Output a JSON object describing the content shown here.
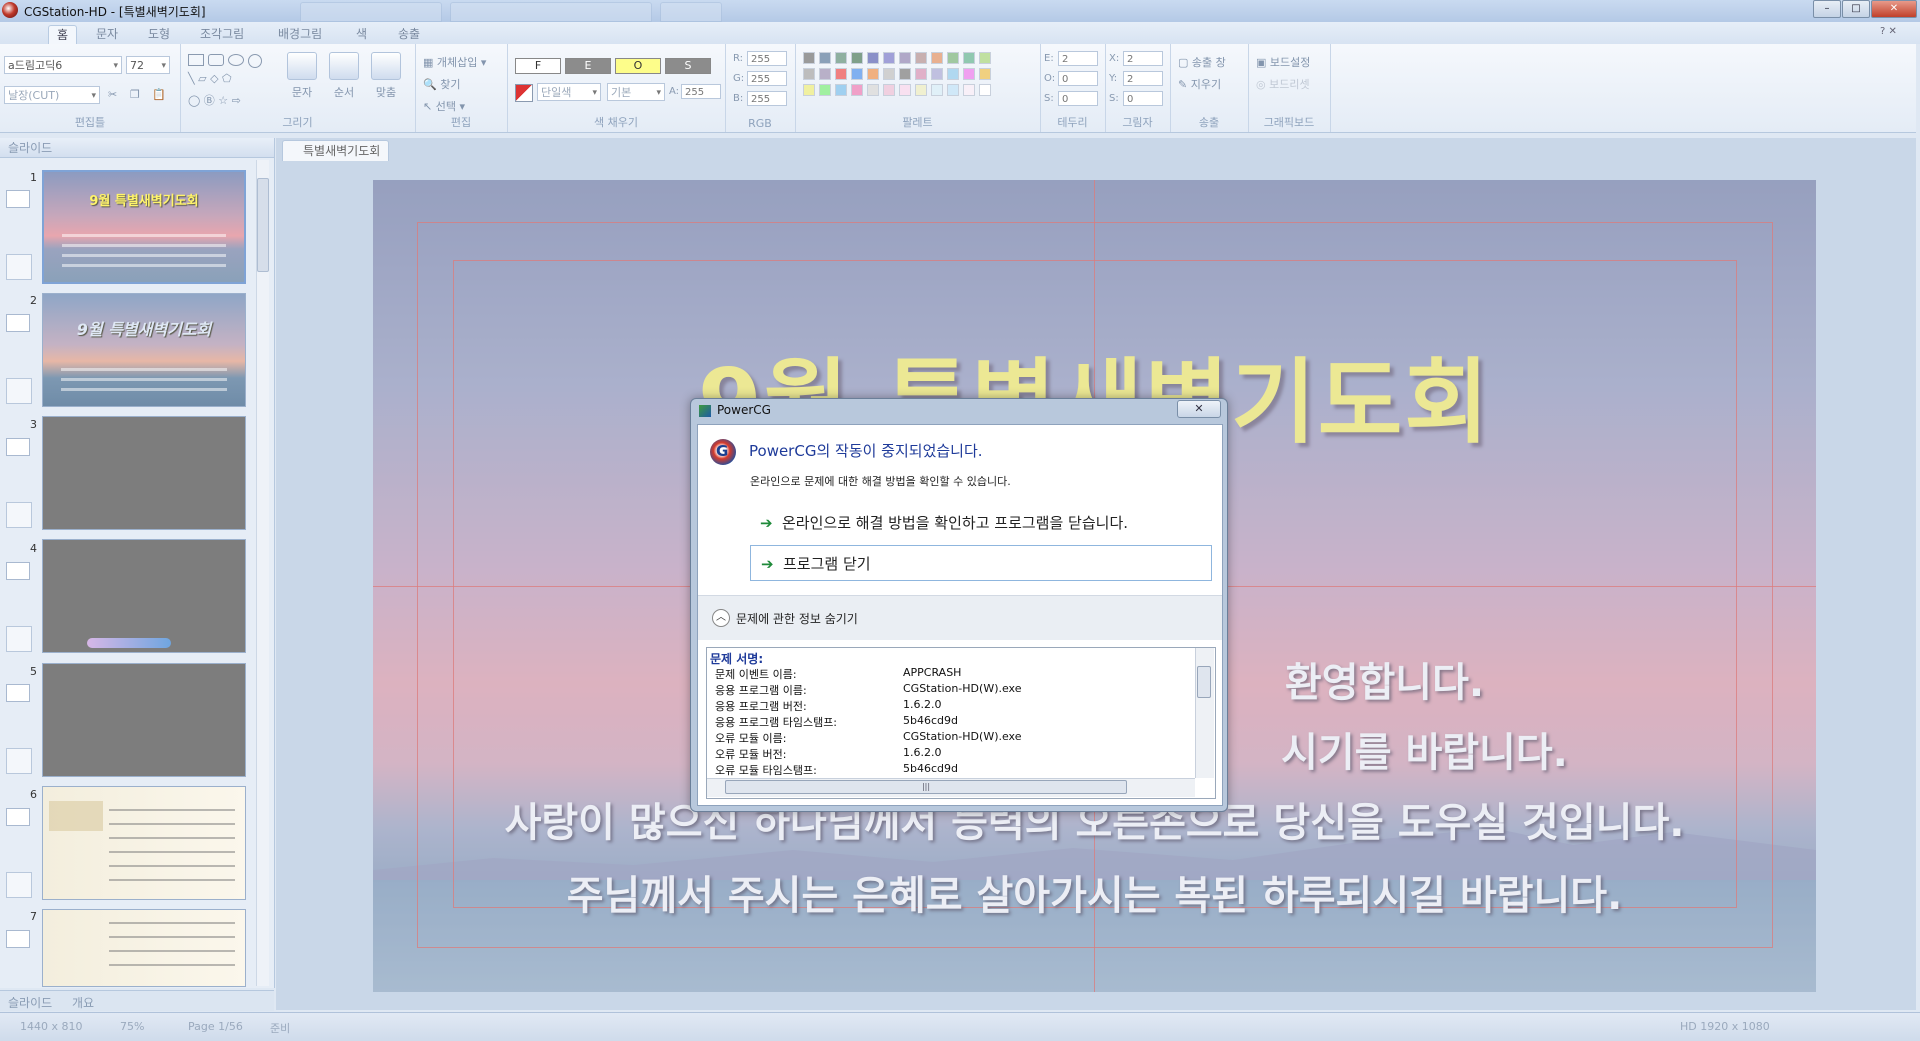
{
  "window": {
    "title": "CGStation-HD - [특별새벽기도회]",
    "controls": [
      "–",
      "□",
      "✕"
    ]
  },
  "ribbon": {
    "tabs": [
      "홈",
      "문자",
      "도형",
      "조각그림",
      "배경그림",
      "색",
      "송출"
    ],
    "help": "? ✕",
    "groups": {
      "edit_group": {
        "label": "편집틀",
        "font": "a드림고딕6",
        "size": "72",
        "mode": "날장(CUT)"
      },
      "draw": {
        "label": "그리기",
        "buttons": [
          "문자",
          "순서",
          "맞춤"
        ]
      },
      "edit": {
        "label": "편집",
        "items": [
          "개체삽입",
          "찾기",
          "선택"
        ]
      },
      "color_fill": {
        "label": "색 채우기",
        "boxes": [
          "F",
          "E",
          "O",
          "S"
        ],
        "fill_type": "단일색",
        "fill_style": "기본",
        "alpha_label": "A:",
        "alpha": "255"
      },
      "rgb": {
        "label": "RGB",
        "r_label": "R:",
        "g_label": "G:",
        "b_label": "B:",
        "r": "255",
        "g": "255",
        "b": "255"
      },
      "palette": {
        "label": "팔레트"
      },
      "border": {
        "label": "테두리",
        "e_label": "E:",
        "o_label": "O:",
        "s_label": "S:",
        "e": "2",
        "o": "0",
        "s": "0"
      },
      "shadow": {
        "label": "그림자",
        "x_label": "X:",
        "y_label": "Y:",
        "s_label": "S:",
        "x": "2",
        "y": "2",
        "s": "0"
      },
      "broadcast": {
        "label": "송출",
        "items": [
          "송출 창",
          "지우기"
        ]
      },
      "graphic_board": {
        "label": "그래픽보드",
        "items": [
          "보드설정",
          "보드리셋"
        ]
      }
    }
  },
  "slide_panel": {
    "header": "슬라이드",
    "slides": [
      {
        "num": "1",
        "title": "9월 특별새벽기도회"
      },
      {
        "num": "2",
        "title": "9월 특별새벽기도회"
      },
      {
        "num": "3",
        "title": ""
      },
      {
        "num": "4",
        "title": ""
      },
      {
        "num": "5",
        "title": ""
      },
      {
        "num": "6",
        "title": ""
      },
      {
        "num": "7",
        "title": ""
      }
    ],
    "bottom_tabs": [
      "슬라이드",
      "개요"
    ]
  },
  "editor": {
    "doc_tab": "특별새벽기도회",
    "slide": {
      "title": "9월 특별새벽기도회",
      "lines": [
        "환영합니다.",
        "시기를 바랍니다.",
        "사랑이 많으신 하나님께서 능력의 오른손으로 당신을 도우실 것입니다.",
        "주님께서 주시는 은혜로 살아가시는 복된 하루되시길 바랍니다."
      ]
    }
  },
  "status_bar": {
    "size": "1440 x 810",
    "zoom": "75%",
    "page": "Page 1/56",
    "state": "준비",
    "resolution": "HD 1920 x 1080"
  },
  "dialog": {
    "title": "PowerCG",
    "close": "✕",
    "heading": "PowerCG의 작동이 중지되었습니다.",
    "subtext": "온라인으로 문제에 대한 해결 방법을 확인할 수 있습니다.",
    "options": [
      "온라인으로 해결 방법을 확인하고 프로그램을 닫습니다.",
      "프로그램 닫기"
    ],
    "details_toggle": "문제에 관한 정보 숨기기",
    "details_header": "문제 서명:",
    "details": [
      {
        "key": "문제 이벤트 이름:",
        "value": "APPCRASH"
      },
      {
        "key": "응용 프로그램 이름:",
        "value": "CGStation-HD(W).exe"
      },
      {
        "key": "응용 프로그램 버전:",
        "value": "1.6.2.0"
      },
      {
        "key": "응용 프로그램 타임스탬프:",
        "value": "5b46cd9d"
      },
      {
        "key": "오류 모듈 이름:",
        "value": "CGStation-HD(W).exe"
      },
      {
        "key": "오류 모듈 버전:",
        "value": "1.6.2.0"
      },
      {
        "key": "오류 모듈 타임스탬프:",
        "value": "5b46cd9d"
      }
    ]
  }
}
